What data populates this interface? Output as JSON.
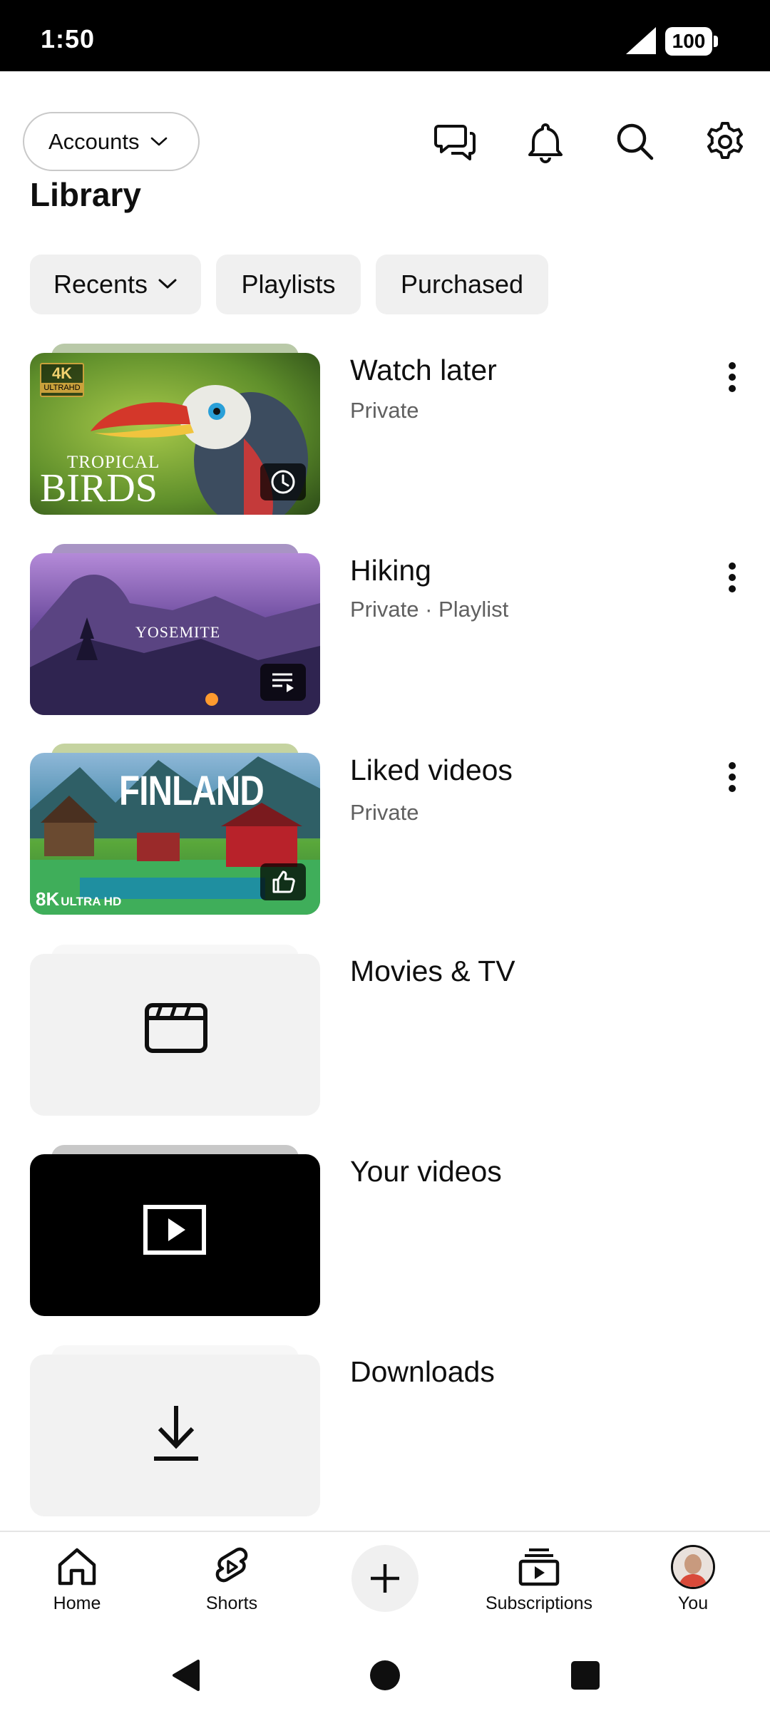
{
  "status_bar": {
    "time": "1:50",
    "battery": "100"
  },
  "header": {
    "accounts_label": "Accounts",
    "title": "Library"
  },
  "filters": [
    {
      "label": "Recents",
      "has_dropdown": true
    },
    {
      "label": "Playlists"
    },
    {
      "label": "Purchased"
    }
  ],
  "library_items": [
    {
      "title": "Watch later",
      "subtitle": "Private",
      "badge_icon": "clock-icon",
      "thumb_text_top": "TROPICAL",
      "thumb_text_main": "BIRDS",
      "thumb_tag": "4K",
      "thumb_tag_sub": "ULTRAHD"
    },
    {
      "title": "Hiking",
      "subtitle": "Private · Playlist",
      "badge_icon": "playlist-icon",
      "thumb_text_main": "YOSEMITE"
    },
    {
      "title": "Liked videos",
      "subtitle": "Private",
      "badge_icon": "thumbs-up-icon",
      "thumb_text_main": "FINLAND",
      "thumb_tag": "8K",
      "thumb_tag_sub": "ULTRA HD"
    },
    {
      "title": "Movies & TV",
      "icon": "clapperboard-icon"
    },
    {
      "title": "Your videos",
      "icon": "play-box-icon"
    },
    {
      "title": "Downloads",
      "icon": "download-icon"
    }
  ],
  "bottom_nav": [
    {
      "label": "Home",
      "icon": "home-icon"
    },
    {
      "label": "Shorts",
      "icon": "shorts-icon"
    },
    {
      "label": "",
      "icon": "plus-icon"
    },
    {
      "label": "Subscriptions",
      "icon": "subscriptions-icon"
    },
    {
      "label": "You",
      "icon": "avatar"
    }
  ],
  "colors": {
    "background": "#ffffff",
    "chip_bg": "#f0f0f0",
    "text_primary": "#0f0f0f",
    "text_secondary": "#606060",
    "status_bar_bg": "#000000"
  }
}
